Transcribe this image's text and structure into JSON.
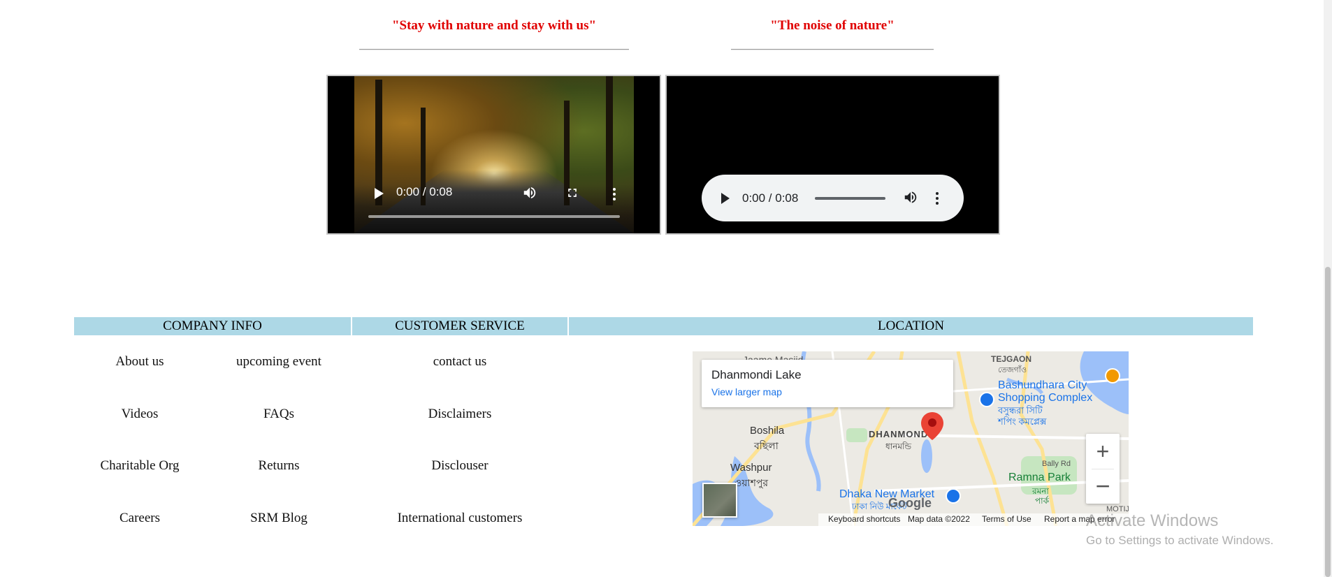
{
  "quotes": [
    {
      "text": "\"Stay with nature and stay with us\""
    },
    {
      "text": "\"The noise of nature\""
    }
  ],
  "video": {
    "time": "0:00 / 0:08",
    "progress": 0
  },
  "audio": {
    "time": "0:00 / 0:08",
    "progress": 0
  },
  "footer": {
    "company_info": {
      "heading": "COMPANY INFO",
      "col1": [
        "About us",
        "Videos",
        "Charitable Org",
        "Careers"
      ],
      "col2": [
        "upcoming event",
        "FAQs",
        "Returns",
        "SRM Blog"
      ]
    },
    "customer_service": {
      "heading": "CUSTOMER SERVICE",
      "links": [
        "contact us",
        "Disclaimers",
        "Disclouser",
        "International customers"
      ]
    },
    "location": {
      "heading": "LOCATION"
    }
  },
  "map": {
    "place_title": "Dhanmondi Lake",
    "larger_map_link": "View larger map",
    "labels": {
      "tejgaon": "TEJGAON",
      "tejgaon_bn": "তেজগাঁও",
      "bashundhara": "Bashundhara City",
      "bashundhara_2": "Shopping Complex",
      "bashundhara_bn": "বসুন্ধরা সিটি",
      "bashundhara_bn2": "শপিং কমপ্লেক্স",
      "jaame": "Jaame Masjid",
      "boshila": "Boshila",
      "boshila_bn": "বছিলা",
      "dhanmondi": "DHANMONDI",
      "dhanmondi_bn": "ধানমন্ডি",
      "washpur": "Washpur",
      "washpur_bn": "ওয়াশপুর",
      "bally_rd": "Bally Rd",
      "ramna": "Ramna Park",
      "ramna_bn": "রমনা",
      "ramna_bn2": "পার্ক",
      "new_market": "Dhaka New Market",
      "new_market_bn": "ঢাকা নিউ মার্কেট",
      "motijheel": "MOTIJH"
    },
    "google_logo": "Google",
    "footer": {
      "shortcuts": "Keyboard shortcuts",
      "data": "Map data ©2022",
      "terms": "Terms of Use",
      "report": "Report a map error"
    },
    "colors": {
      "marker": "#ea4335",
      "water": "#9cc0f9",
      "park": "#c6e6c0",
      "road": "#fde293"
    }
  },
  "watermark": {
    "title": "Activate Windows",
    "subtitle": "Go to Settings to activate Windows."
  }
}
